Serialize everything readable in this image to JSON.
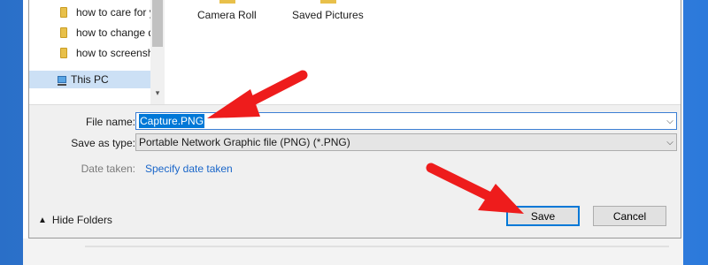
{
  "navigation": {
    "folders": [
      {
        "label": "how to care for y"
      },
      {
        "label": "how to change d"
      },
      {
        "label": "how to screensho"
      }
    ],
    "this_pc": "This PC"
  },
  "content": {
    "items": [
      {
        "label": "Camera Roll"
      },
      {
        "label": "Saved Pictures"
      }
    ]
  },
  "form": {
    "file_name_label": "File name:",
    "file_name_value": "Capture.PNG",
    "save_as_type_label": "Save as type:",
    "save_as_type_value": "Portable Network Graphic file (PNG) (*.PNG)",
    "date_taken_label": "Date taken:",
    "date_taken_link": "Specify date taken"
  },
  "footer": {
    "hide_folders": "Hide Folders",
    "save": "Save",
    "cancel": "Cancel"
  },
  "colors": {
    "accent": "#0078d7",
    "link": "#1a66c9",
    "annotation_arrow": "#ee1c1c",
    "desktop": "#2c79db"
  },
  "icons": {
    "folder": "folder-icon",
    "computer": "computer-icon",
    "dropdown": "chevron-down-icon",
    "hide": "chevron-up-icon",
    "annotation": "red-arrow-icon"
  }
}
